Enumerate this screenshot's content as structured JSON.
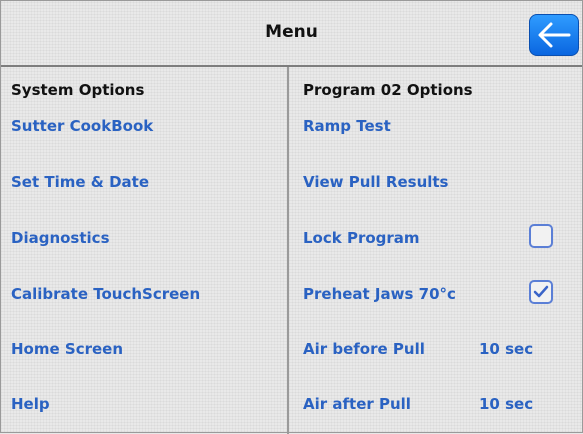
{
  "header": {
    "title": "Menu",
    "back_icon": "arrow-left-icon"
  },
  "system_options": {
    "heading": "System Options",
    "items": [
      "Sutter CookBook",
      "Set Time & Date",
      "Diagnostics",
      "Calibrate TouchScreen",
      "Home Screen",
      "Help"
    ]
  },
  "program_options": {
    "heading": "Program 02 Options",
    "ramp_test": "Ramp Test",
    "view_pull_results": "View Pull Results",
    "lock_program": {
      "label": "Lock Program",
      "checked": false
    },
    "preheat_jaws": {
      "label": "Preheat Jaws 70°c",
      "checked": true
    },
    "air_before_pull": {
      "label": "Air before Pull",
      "value": "10 sec"
    },
    "air_after_pull": {
      "label": "Air after Pull",
      "value": "10 sec"
    }
  },
  "colors": {
    "link": "#2a62c2",
    "accent": "#0a66e0",
    "text": "#111111"
  }
}
